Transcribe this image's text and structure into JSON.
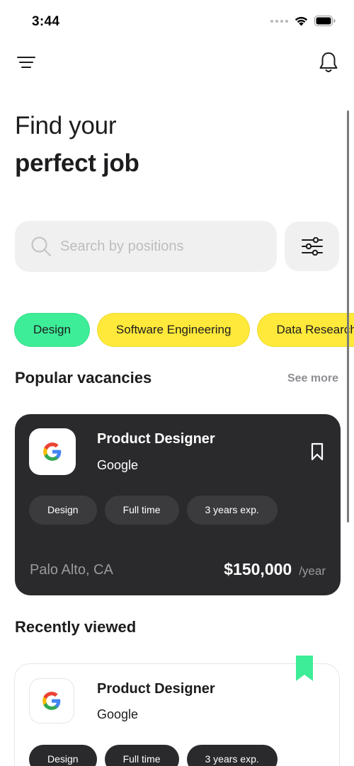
{
  "status_bar": {
    "time": "3:44"
  },
  "header": {
    "menu_icon": "hamburger-menu-icon",
    "notification_icon": "bell-icon"
  },
  "headline": {
    "line1": "Find your",
    "line2": "perfect job"
  },
  "search": {
    "placeholder": "Search by positions",
    "value": "",
    "icon": "search-icon",
    "filter_icon": "sliders-icon"
  },
  "categories": [
    {
      "label": "Design",
      "active": true,
      "color": "#3ded97"
    },
    {
      "label": "Software Engineering",
      "active": false,
      "color": "#ffe93a"
    },
    {
      "label": "Data Research",
      "active": false,
      "color": "#ffe93a"
    }
  ],
  "popular": {
    "title": "Popular vacancies",
    "see_more": "See more",
    "card": {
      "title": "Product Designer",
      "company": "Google",
      "tags": [
        "Design",
        "Full time",
        "3 years exp."
      ],
      "location": "Palo Alto, CA",
      "salary": "$150,000",
      "period": "/year",
      "bookmark_icon": "bookmark-outline-icon",
      "background": "#2a2a2c"
    }
  },
  "recent": {
    "title": "Recently viewed",
    "card": {
      "title": "Product Designer",
      "company": "Google",
      "tags": [
        "Design",
        "Full time",
        "3 years exp."
      ],
      "bookmark_icon": "bookmark-filled-icon",
      "bookmark_color": "#3ded97"
    }
  }
}
